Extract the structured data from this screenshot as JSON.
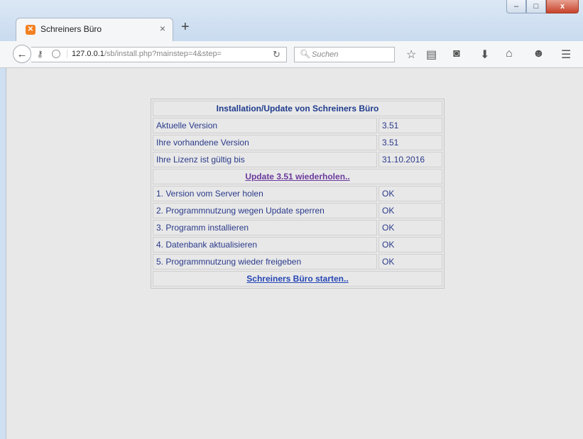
{
  "browser": {
    "tab_title": "Schreiners Büro",
    "tab_close": "×",
    "new_tab": "+",
    "url_host": "127.0.0.1",
    "url_path": "/sb/install.php?mainstep=4&step=",
    "search_placeholder": "Suchen",
    "window_buttons": [
      "–",
      "□",
      "x"
    ]
  },
  "table": {
    "title": "Installation/Update von Schreiners Büro",
    "info_rows": [
      {
        "label": "Aktuelle Version",
        "value": "3.51"
      },
      {
        "label": "Ihre vorhandene Version",
        "value": "3.51"
      },
      {
        "label": "Ihre Lizenz ist gültig bis",
        "value": "31.10.2016"
      }
    ],
    "update_link": "Update 3.51 wiederholen..",
    "steps": [
      {
        "label": "1. Version vom Server holen",
        "status": "OK"
      },
      {
        "label": "2. Programmnutzung wegen Update sperren",
        "status": "OK"
      },
      {
        "label": "3. Programm installieren",
        "status": "OK"
      },
      {
        "label": "4. Datenbank aktualisieren",
        "status": "OK"
      },
      {
        "label": "5. Programmnutzung wieder freigeben",
        "status": "OK"
      }
    ],
    "start_link": "Schreiners Büro starten.."
  }
}
